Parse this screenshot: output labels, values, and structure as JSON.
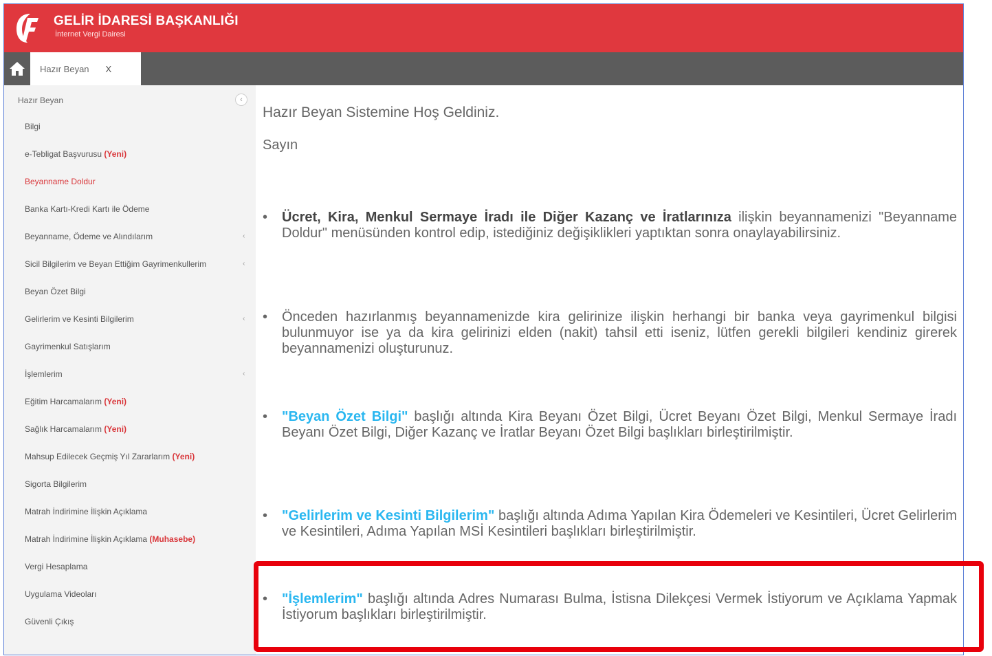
{
  "header": {
    "org_title": "GELİR İDARESİ BAŞKANLIĞI",
    "org_subtitle": "İnternet Vergi Dairesi"
  },
  "tabs": [
    {
      "label": "Hazır Beyan",
      "close": "X"
    }
  ],
  "sidebar": {
    "header_label": "Hazır Beyan",
    "header_button": "‹",
    "items": [
      {
        "label": "Bilgi"
      },
      {
        "label": "e-Tebligat Başvurusu ",
        "badge": "(Yeni)"
      },
      {
        "label": "Beyanname Doldur"
      },
      {
        "label": "Banka Kartı-Kredi Kartı ile Ödeme"
      },
      {
        "label": "Beyanname, Ödeme ve Alındılarım",
        "chevron": "‹"
      },
      {
        "label": "Sicil Bilgilerim ve Beyan Ettiğim Gayrimenkullerim",
        "chevron": "‹"
      },
      {
        "label": "Beyan Özet Bilgi"
      },
      {
        "label": "Gelirlerim ve Kesinti Bilgilerim",
        "chevron": "‹"
      },
      {
        "label": "Gayrimenkul Satışlarım"
      },
      {
        "label": "İşlemlerim",
        "chevron": "‹"
      },
      {
        "label": "Eğitim Harcamalarım ",
        "badge": "(Yeni)"
      },
      {
        "label": "Sağlık Harcamalarım ",
        "badge": "(Yeni)"
      },
      {
        "label": "Mahsup Edilecek Geçmiş Yıl Zararlarım ",
        "badge": "(Yeni)"
      },
      {
        "label": "Sigorta Bilgilerim"
      },
      {
        "label": "Matrah İndirimine İlişkin Açıklama"
      },
      {
        "label": "Matrah İndirimine İlişkin Açıklama ",
        "badge": "(Muhasebe)"
      },
      {
        "label": "Vergi Hesaplama"
      },
      {
        "label": "Uygulama Videoları"
      },
      {
        "label": "Güvenli Çıkış"
      }
    ]
  },
  "content": {
    "welcome": "Hazır Beyan Sistemine Hoş Geldiniz.",
    "salutation": "Sayın",
    "bullet": "•",
    "paragraphs": [
      {
        "strong": "Ücret, Kira, Menkul Sermaye İradı ile Diğer Kazanç ve İratlarınıza",
        "text": " ilişkin beyannamenizi \"Beyanname Doldur\" menüsünden kontrol edip, istediğiniz değişiklikleri yaptıktan sonra onaylayabilirsiniz."
      },
      {
        "text": "Önceden hazırlanmış beyannamenizde kira gelirinize ilişkin herhangi bir banka veya gayrimenkul bilgisi bulunmuyor ise ya da kira gelirinizi elden (nakit) tahsil etti iseniz, lütfen gerekli bilgileri kendiniz girerek beyannamenizi oluşturunuz."
      },
      {
        "link": "\"Beyan Özet Bilgi\"",
        "text": " başlığı altında Kira Beyanı Özet Bilgi, Ücret Beyanı Özet Bilgi, Menkul Sermaye İradı Beyanı Özet Bilgi, Diğer Kazanç ve İratlar Beyanı Özet Bilgi başlıkları birleştirilmiştir."
      },
      {
        "link": "\"Gelirlerim ve Kesinti Bilgilerim\"",
        "text": " başlığı altında Adıma Yapılan Kira Ödemeleri ve Kesintileri, Ücret Gelirlerim ve Kesintileri, Adıma Yapılan MSİ Kesintileri başlıkları birleştirilmiştir."
      },
      {
        "link": "\"İşlemlerim\"",
        "text": " başlığı altında Adres Numarası Bulma, İstisna Dilekçesi Vermek İstiyorum ve Açıklama Yapmak İstiyorum başlıkları birleştirilmiştir."
      }
    ]
  },
  "colors": {
    "header_red": "#e0383e",
    "tabbar_gray": "#5c5c5c",
    "link_blue": "#2ab7f0",
    "badge_red": "#d9373b",
    "highlight_red": "#e8000b"
  },
  "icons": {
    "logo": "gib-logo-icon",
    "home": "home-icon"
  }
}
